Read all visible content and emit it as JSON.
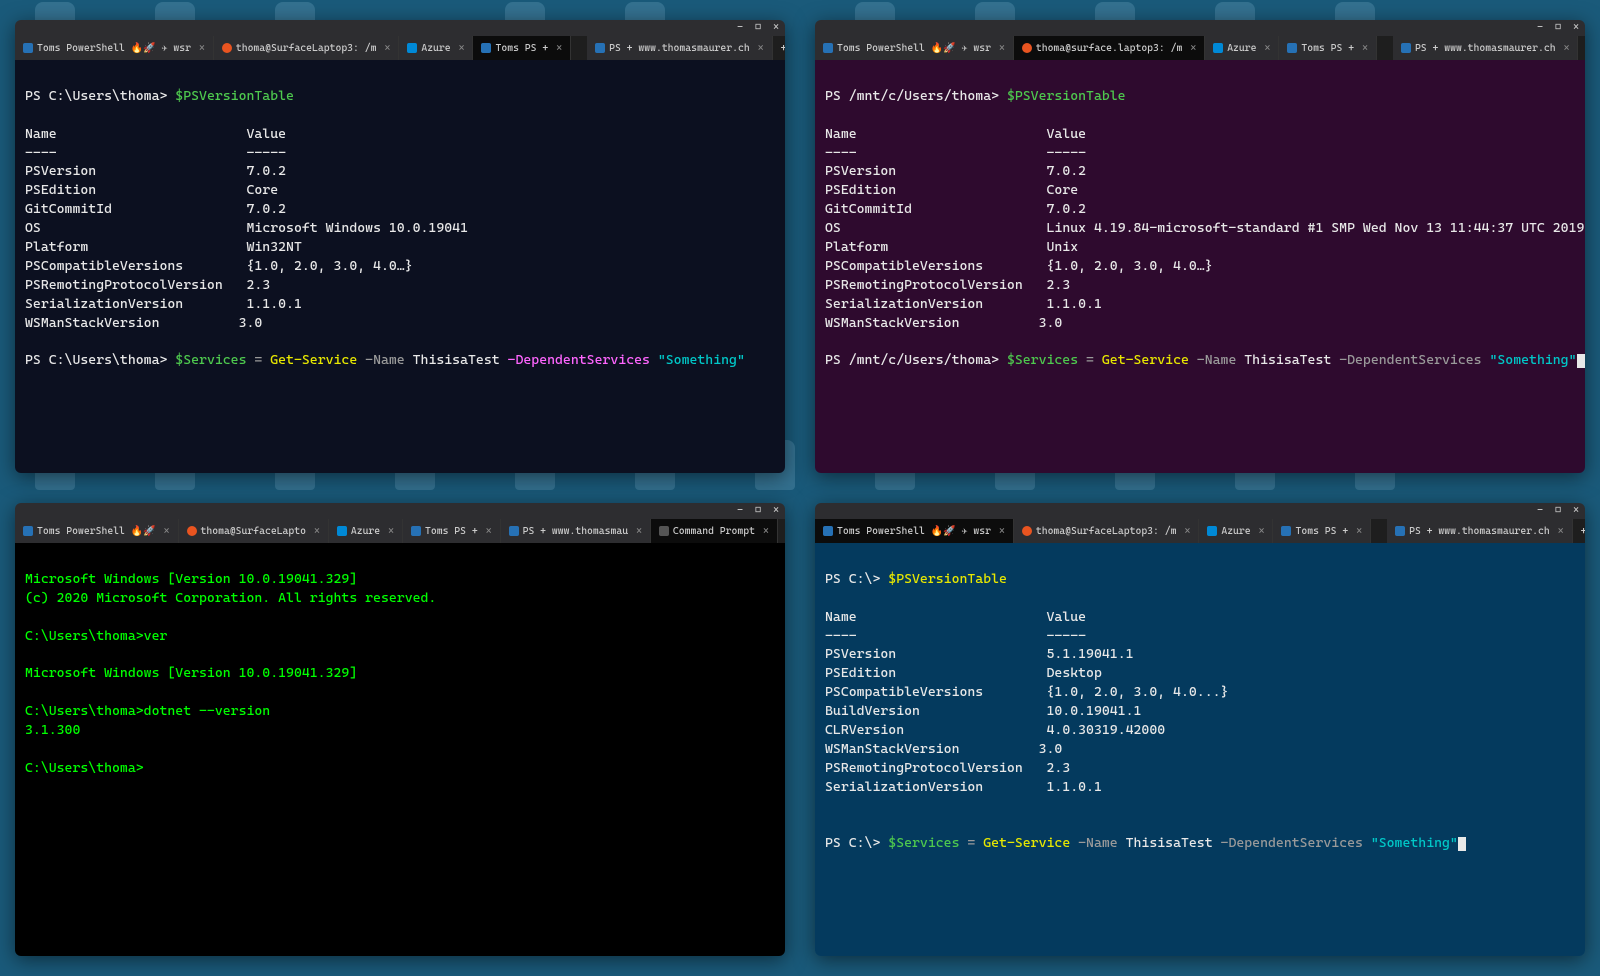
{
  "windows": {
    "top_left": {
      "tabs": [
        {
          "icon": "ps",
          "label": "Toms PowerShell 🔥🚀 ✈ wsr",
          "close": true
        },
        {
          "icon": "linux",
          "label": "thoma@SurfaceLaptop3: /m ",
          "close": true
        },
        {
          "icon": "azure",
          "label": "Azure",
          "close": true
        },
        {
          "icon": "ps",
          "label": "Toms PS +",
          "close": true,
          "active": true
        }
      ],
      "extra_tabs": [
        {
          "icon": "ps",
          "label": "PS + www.thomasmaurer.ch",
          "close": true
        }
      ],
      "prompt1": "PS C:\\Users\\thoma> ",
      "cmd1": "$PSVersionTable",
      "headers": {
        "name": "Name",
        "value": "Value",
        "nameDiv": "----",
        "valueDiv": "-----"
      },
      "rows": [
        {
          "k": "PSVersion",
          "v": "7.0.2"
        },
        {
          "k": "PSEdition",
          "v": "Core"
        },
        {
          "k": "GitCommitId",
          "v": "7.0.2"
        },
        {
          "k": "OS",
          "v": "Microsoft Windows 10.0.19041"
        },
        {
          "k": "Platform",
          "v": "Win32NT"
        },
        {
          "k": "PSCompatibleVersions",
          "v": "{1.0, 2.0, 3.0, 4.0…}"
        },
        {
          "k": "PSRemotingProtocolVersion",
          "v": "2.3"
        },
        {
          "k": "SerializationVersion",
          "v": "1.1.0.1"
        },
        {
          "k": "WSManStackVersion",
          "v": "3.0"
        }
      ],
      "prompt2": "PS C:\\Users\\thoma> ",
      "cmd2": {
        "var": "$Services",
        "eq": " = ",
        "cmdlet": "Get-Service",
        "p1": " -Name ",
        "a1": "ThisisaTest",
        "p2": " -DependentServices ",
        "a2": "\"Something\""
      }
    },
    "top_right": {
      "tabs": [
        {
          "icon": "ps",
          "label": "Toms PowerShell 🔥🚀 ✈ wsr",
          "close": true
        },
        {
          "icon": "linux",
          "label": "thoma@surface.laptop3: /m",
          "close": true,
          "active": true
        },
        {
          "icon": "azure",
          "label": "Azure",
          "close": true
        },
        {
          "icon": "ps",
          "label": "Toms PS +",
          "close": true
        }
      ],
      "extra_tabs": [
        {
          "icon": "ps",
          "label": "PS + www.thomasmaurer.ch",
          "close": true
        }
      ],
      "prompt1": "PS /mnt/c/Users/thoma> ",
      "cmd1": "$PSVersionTable",
      "headers": {
        "name": "Name",
        "value": "Value",
        "nameDiv": "----",
        "valueDiv": "-----"
      },
      "rows": [
        {
          "k": "PSVersion",
          "v": "7.0.2"
        },
        {
          "k": "PSEdition",
          "v": "Core"
        },
        {
          "k": "GitCommitId",
          "v": "7.0.2"
        },
        {
          "k": "OS",
          "v": "Linux 4.19.84-microsoft-standard #1 SMP Wed Nov 13 11:44:37 UTC 2019"
        },
        {
          "k": "Platform",
          "v": "Unix"
        },
        {
          "k": "PSCompatibleVersions",
          "v": "{1.0, 2.0, 3.0, 4.0…}"
        },
        {
          "k": "PSRemotingProtocolVersion",
          "v": "2.3"
        },
        {
          "k": "SerializationVersion",
          "v": "1.1.0.1"
        },
        {
          "k": "WSManStackVersion",
          "v": "3.0"
        }
      ],
      "prompt2": "PS /mnt/c/Users/thoma> ",
      "cmd2": {
        "var": "$Services",
        "eq": " = ",
        "cmdlet": "Get-Service",
        "p1": " -Name ",
        "a1": "ThisisaTest",
        "p2": " -DependentServices ",
        "a2": "\"Something\""
      }
    },
    "bottom_left": {
      "tabs": [
        {
          "icon": "ps",
          "label": "Toms PowerShell 🔥🚀",
          "close": true
        },
        {
          "icon": "linux",
          "label": "thoma@SurfaceLapto",
          "close": true
        },
        {
          "icon": "azure",
          "label": "Azure",
          "close": true
        },
        {
          "icon": "ps",
          "label": "Toms PS +",
          "close": true
        },
        {
          "icon": "ps",
          "label": "PS + www.thomasmau",
          "close": true
        },
        {
          "icon": "cmd",
          "label": "Command Prompt",
          "close": true,
          "active": true
        }
      ],
      "lines": [
        "Microsoft Windows [Version 10.0.19041.329]",
        "(c) 2020 Microsoft Corporation. All rights reserved.",
        "",
        "C:\\Users\\thoma>ver",
        "",
        "Microsoft Windows [Version 10.0.19041.329]",
        "",
        "C:\\Users\\thoma>dotnet --version",
        "3.1.300",
        "",
        "C:\\Users\\thoma>"
      ]
    },
    "bottom_right": {
      "tabs": [
        {
          "icon": "ps",
          "label": "Toms PowerShell 🔥🚀 ✈ wsr",
          "close": true,
          "active": true
        },
        {
          "icon": "linux",
          "label": "thoma@SurfaceLaptop3: /m",
          "close": true
        },
        {
          "icon": "azure",
          "label": "Azure",
          "close": true
        },
        {
          "icon": "ps",
          "label": "Toms PS +",
          "close": true
        }
      ],
      "extra_tabs": [
        {
          "icon": "ps",
          "label": "PS + www.thomasmaurer.ch",
          "close": true
        }
      ],
      "prompt1": "PS C:\\> ",
      "cmd1": "$PSVersionTable",
      "headers": {
        "name": "Name",
        "value": "Value",
        "nameDiv": "----",
        "valueDiv": "-----"
      },
      "rows": [
        {
          "k": "PSVersion",
          "v": "5.1.19041.1"
        },
        {
          "k": "PSEdition",
          "v": "Desktop"
        },
        {
          "k": "PSCompatibleVersions",
          "v": "{1.0, 2.0, 3.0, 4.0...}"
        },
        {
          "k": "BuildVersion",
          "v": "10.0.19041.1"
        },
        {
          "k": "CLRVersion",
          "v": "4.0.30319.42000"
        },
        {
          "k": "WSManStackVersion",
          "v": "3.0"
        },
        {
          "k": "PSRemotingProtocolVersion",
          "v": "2.3"
        },
        {
          "k": "SerializationVersion",
          "v": "1.1.0.1"
        }
      ],
      "prompt2": "PS C:\\> ",
      "cmd2": {
        "var": "$Services",
        "eq": " = ",
        "cmdlet": "Get-Service",
        "p1": " -Name ",
        "a1": "ThisisaTest",
        "p2": " -DependentServices ",
        "a2": "\"Something\""
      }
    }
  },
  "window_controls": {
    "min": "−",
    "max": "□",
    "close": "×"
  },
  "new_tab": "+",
  "dropdown": "⌄"
}
